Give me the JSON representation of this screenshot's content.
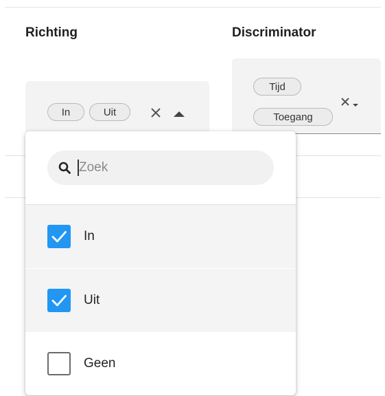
{
  "columns": {
    "richting": {
      "header": "Richting"
    },
    "discriminator": {
      "header": "Discriminator"
    }
  },
  "richting_field": {
    "chips": [
      "In",
      "Uit"
    ],
    "open": true
  },
  "discriminator_field": {
    "chips": [
      "Tijd",
      "Toegang"
    ]
  },
  "dropdown": {
    "search": {
      "placeholder": "Zoek",
      "value": ""
    },
    "options": [
      {
        "label": "In",
        "checked": true
      },
      {
        "label": "Uit",
        "checked": true
      },
      {
        "label": "Geen",
        "checked": false
      }
    ]
  },
  "colors": {
    "accent": "#2196f3",
    "field_bg": "#f3f3f3",
    "chip_bg": "#ececec"
  }
}
